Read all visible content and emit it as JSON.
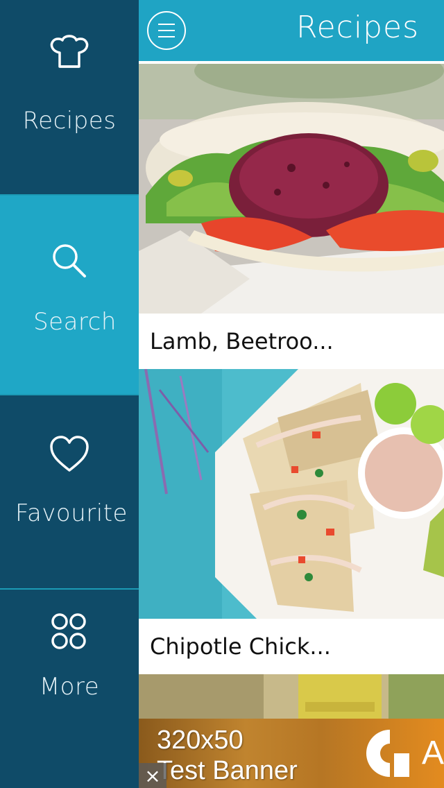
{
  "sidebar": {
    "items": [
      {
        "label": "Recipes",
        "icon": "chef-hat-icon"
      },
      {
        "label": "Search",
        "icon": "search-icon",
        "active": true
      },
      {
        "label": "Favourite",
        "icon": "heart-icon"
      },
      {
        "label": "More",
        "icon": "grid-circles-icon"
      }
    ]
  },
  "header": {
    "title": "Recipes",
    "menu_icon": "hamburger-menu-icon"
  },
  "recipes": [
    {
      "title": "Lamb, Beetroo..."
    },
    {
      "title": "Chipotle Chick..."
    }
  ],
  "ad": {
    "line1": "320x50",
    "line2": "Test Banner",
    "logo_letter": "A",
    "close_label": "×"
  },
  "colors": {
    "sidebar": "#0f4b68",
    "active": "#1fa7c6",
    "header": "#1fa4c4"
  }
}
